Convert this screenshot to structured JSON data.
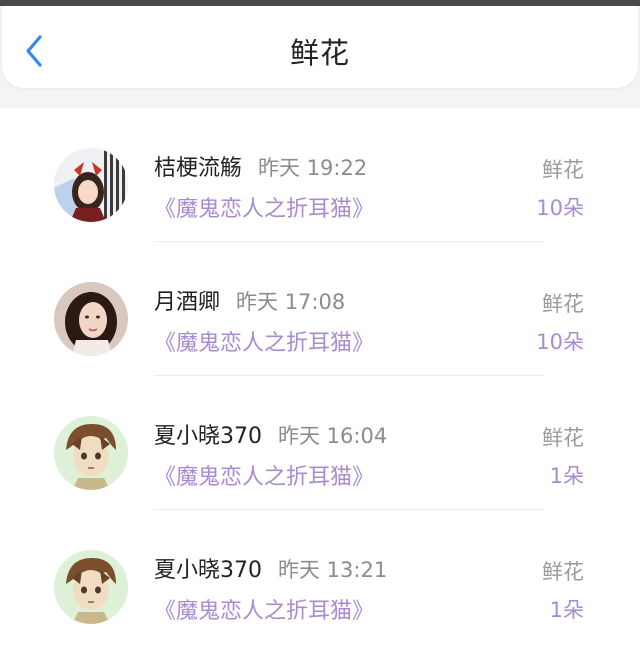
{
  "header": {
    "title": "鲜花",
    "back_icon": "chevron-left-icon",
    "accent": "#2d8cf0"
  },
  "records": [
    {
      "user": "桔梗流觞",
      "time": "昨天 19:22",
      "book": "《魔鬼恋人之折耳猫》",
      "gift_type": "鲜花",
      "gift_count": "10朵",
      "avatar": "anime-girl-red-bow"
    },
    {
      "user": "月酒卿",
      "time": "昨天 17:08",
      "book": "《魔鬼恋人之折耳猫》",
      "gift_type": "鲜花",
      "gift_count": "10朵",
      "avatar": "woman-portrait"
    },
    {
      "user": "夏小晓370",
      "time": "昨天 16:04",
      "book": "《魔鬼恋人之折耳猫》",
      "gift_type": "鲜花",
      "gift_count": "1朵",
      "avatar": "anime-boy-brown-hair"
    },
    {
      "user": "夏小晓370",
      "time": "昨天 13:21",
      "book": "《魔鬼恋人之折耳猫》",
      "gift_type": "鲜花",
      "gift_count": "1朵",
      "avatar": "anime-boy-brown-hair"
    }
  ],
  "colors": {
    "book_link": "#a98bd0",
    "time_text": "#8c8c8c",
    "background": "#f4f4f6"
  }
}
